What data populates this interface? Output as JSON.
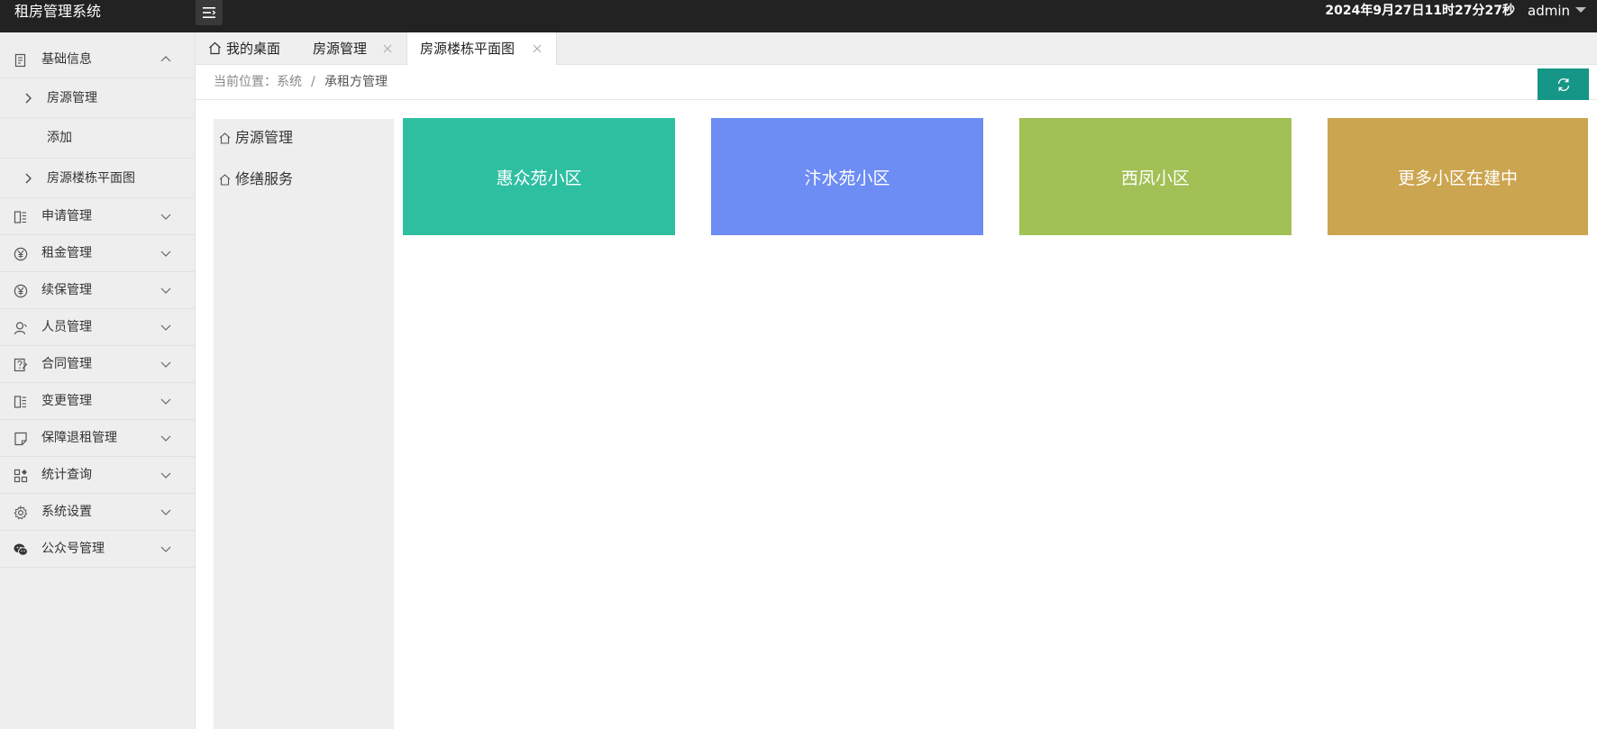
{
  "app": {
    "title": "租房管理系统",
    "clock": "2024年9月27日11时27分27秒",
    "user": "admin"
  },
  "sidebar": {
    "items": [
      {
        "label": "基础信息",
        "icon": "document-icon",
        "expanded": true,
        "children": [
          {
            "label": "房源管理",
            "arrow": true
          },
          {
            "label": "添加",
            "arrow": false
          },
          {
            "label": "房源楼栋平面图",
            "arrow": true
          }
        ]
      },
      {
        "label": "申请管理",
        "icon": "form-icon"
      },
      {
        "label": "租金管理",
        "icon": "yen-icon"
      },
      {
        "label": "续保管理",
        "icon": "yen-icon"
      },
      {
        "label": "人员管理",
        "icon": "user-icon"
      },
      {
        "label": "合同管理",
        "icon": "contract-icon"
      },
      {
        "label": "变更管理",
        "icon": "form-icon"
      },
      {
        "label": "保障退租管理",
        "icon": "note-icon"
      },
      {
        "label": "统计查询",
        "icon": "grid-icon"
      },
      {
        "label": "系统设置",
        "icon": "gear-icon"
      },
      {
        "label": "公众号管理",
        "icon": "wechat-icon"
      }
    ]
  },
  "tabs": [
    {
      "label": "我的桌面",
      "icon": "home-icon"
    },
    {
      "label": "房源管理",
      "closable": true
    },
    {
      "label": "房源楼栋平面图",
      "closable": true,
      "active": true
    }
  ],
  "breadcrumb": {
    "prefix": "当前位置：",
    "level1": "系统",
    "separator": "/",
    "current": "承租方管理"
  },
  "inner_nav": [
    {
      "label": "房源管理",
      "icon": "home-icon"
    },
    {
      "label": "修缮服务",
      "icon": "home-icon"
    }
  ],
  "cards": [
    {
      "label": "惠众苑小区",
      "color": "#2ebfa1"
    },
    {
      "label": "汴水苑小区",
      "color": "#6d8cf4"
    },
    {
      "label": "西凤小区",
      "color": "#a1c055"
    },
    {
      "label": "更多小区在建中",
      "color": "#cca550"
    }
  ],
  "colors": {
    "topbar": "#222222",
    "accent": "#159687",
    "sidebar": "#eeeeee"
  }
}
